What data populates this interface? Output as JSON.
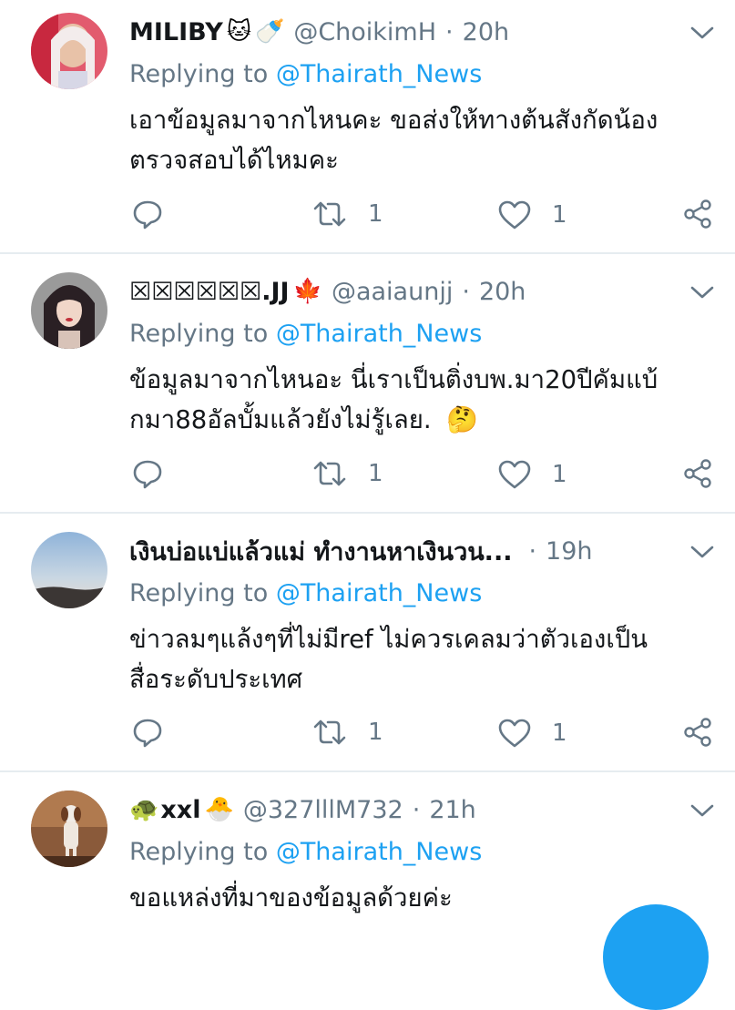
{
  "replying_label": "Replying to",
  "replying_handle": "@Thairath_News",
  "colors": {
    "link": "#1da1f2",
    "muted": "#657786",
    "text": "#14171a",
    "divider": "#e6ecf0"
  },
  "tweets": [
    {
      "name": "MILIBY",
      "emojis": [
        "cat-face-emoji",
        "baby-bottle-emoji"
      ],
      "handle": "@ChoikimH",
      "time": "20h",
      "body_lines": [
        "เอาข้อมูลมาจากไหนคะ ขอส่งให้ทางต้นสังกัดน้อง",
        "ตรวจสอบได้ไหมคะ"
      ],
      "retweets": "1",
      "likes": "1"
    },
    {
      "name": "☒☒☒☒☒☒.JJ",
      "emojis": [
        "maple-leaf-emoji"
      ],
      "handle": "@aaiaunjj",
      "time": "20h",
      "body_lines": [
        "ข้อมูลมาจากไหนอะ นี่เราเป็นติ่งบพ.มา20ปีคัมแบ้",
        "กมา88อัลบั้มแล้วยังไม่รู้เลย."
      ],
      "body_emoji": "thinking-face-emoji",
      "retweets": "1",
      "likes": "1"
    },
    {
      "name": "เงินบ่อแบ่แล้วแม่ ทำงานหาเงินวน...",
      "emojis": [],
      "handle": "",
      "time": "19h",
      "body_lines": [
        "ข่าวลมๆแล้งๆที่ไม่มีref ไม่ควรเคลมว่าตัวเองเป็น",
        "สื่อระดับประเทศ"
      ],
      "retweets": "1",
      "likes": "1"
    },
    {
      "name": "xxl",
      "emojis": [
        "turtle-emoji",
        "hatching-chick-emoji"
      ],
      "handle": "@327lllM732",
      "time": "21h",
      "body_lines": [
        "ขอแหล่งที่มาของข้อมูลด้วยค่ะ"
      ]
    }
  ]
}
